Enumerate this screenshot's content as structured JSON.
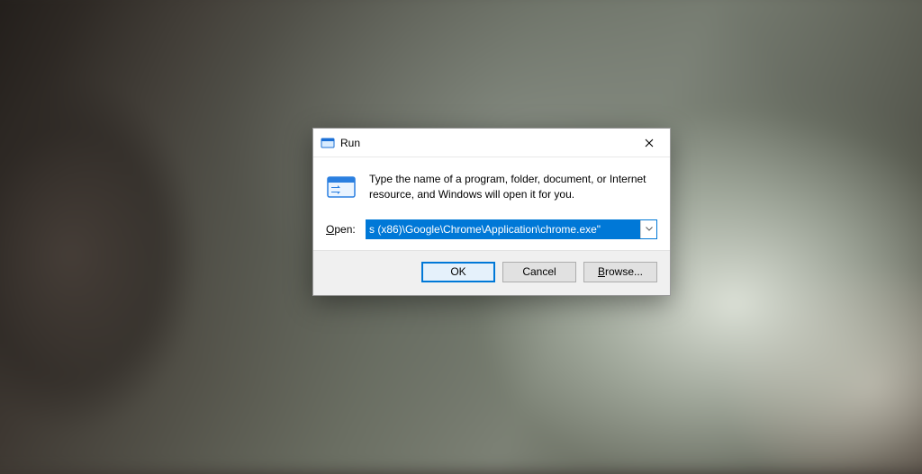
{
  "dialog": {
    "title": "Run",
    "description": "Type the name of a program, folder, document, or Internet resource, and Windows will open it for you.",
    "open_label_prefix": "",
    "open_label_hotkey": "O",
    "open_label_suffix": "pen:",
    "input_value": "s (x86)\\Google\\Chrome\\Application\\chrome.exe\"",
    "buttons": {
      "ok": "OK",
      "cancel": "Cancel",
      "browse_hotkey": "B",
      "browse_suffix": "rowse..."
    }
  }
}
